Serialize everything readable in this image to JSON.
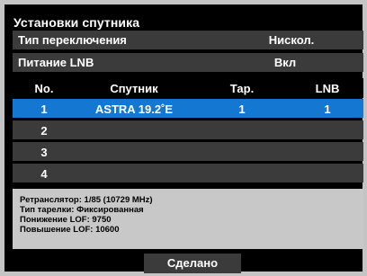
{
  "title": "Установки спутника",
  "settings": [
    {
      "label": "Тип переключения",
      "value": "Нискол."
    },
    {
      "label": "Питание LNB",
      "value": "Вкл"
    }
  ],
  "table": {
    "headers": [
      "No.",
      "Спутник",
      "Тар.",
      "LNB"
    ],
    "rows": [
      {
        "no": "1",
        "satellite": "ASTRA 19.2˚E",
        "dish": "1",
        "lnb": "1",
        "selected": true
      },
      {
        "no": "2",
        "satellite": "",
        "dish": "",
        "lnb": ""
      },
      {
        "no": "3",
        "satellite": "",
        "dish": "",
        "lnb": ""
      },
      {
        "no": "4",
        "satellite": "",
        "dish": "",
        "lnb": ""
      }
    ]
  },
  "info": [
    "Ретранслятор: 1/85 (10729 MHz)",
    "Тип тарелки: Фиксированная",
    "Понижение LOF: 9750",
    "Повышение LOF: 10600"
  ],
  "done_label": "Сделано",
  "colors": {
    "background": "#c4c4c4",
    "panel": "#000000",
    "row": "#3b3b3b",
    "selected": "#1478d2",
    "info_bg": "#c8c8c8"
  }
}
